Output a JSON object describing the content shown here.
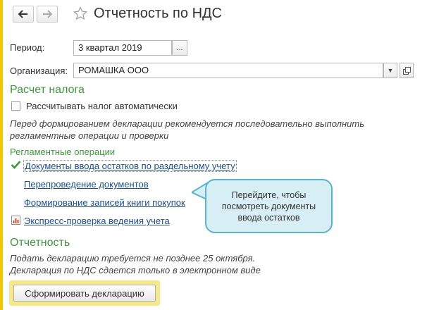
{
  "header": {
    "title": "Отчетность по НДС",
    "back_icon": "arrow-left",
    "forward_icon": "arrow-right",
    "favorite_icon": "star"
  },
  "period": {
    "label": "Период:",
    "value": "3 квартал 2019",
    "select_label": "..."
  },
  "organization": {
    "label": "Организация:",
    "value": "РОМАШКА ООО",
    "dropdown_icon": "chevron-down",
    "open_icon": "open-window"
  },
  "tax_calc": {
    "heading": "Расчет налога",
    "auto_checkbox_label": "Рассчитывать налог автоматически",
    "auto_checked": false,
    "note_line1": "Перед формированием декларации рекомендуется последовательно выполнить",
    "note_line2": "регламентные операции и проверки"
  },
  "operations": {
    "heading": "Регламентные операции",
    "items": [
      {
        "label": "Документы ввода остатков по раздельному учету",
        "icon": "checkmark",
        "done": true
      },
      {
        "label": "Перепроведение документов"
      },
      {
        "label": "Формирование записей книги покупок"
      },
      {
        "label": "Экспресс-проверка ведения учета",
        "icon": "report"
      }
    ]
  },
  "tooltip": {
    "text": "Перейдите, чтобы посмотреть документы ввода остатков"
  },
  "reporting": {
    "heading": "Отчетность",
    "note_line1": "Подать декларацию требуется не позднее 25 октября.",
    "note_line2": "Декларация по НДС сдается только в электронном виде",
    "button_label": "Сформировать декларацию"
  },
  "colors": {
    "accent_green": "#3c9a3c",
    "link_blue": "#1a4f9c",
    "highlight_yellow": "#f7e98a",
    "tooltip_bg": "#d7eef5",
    "tooltip_border": "#55b6cf"
  }
}
